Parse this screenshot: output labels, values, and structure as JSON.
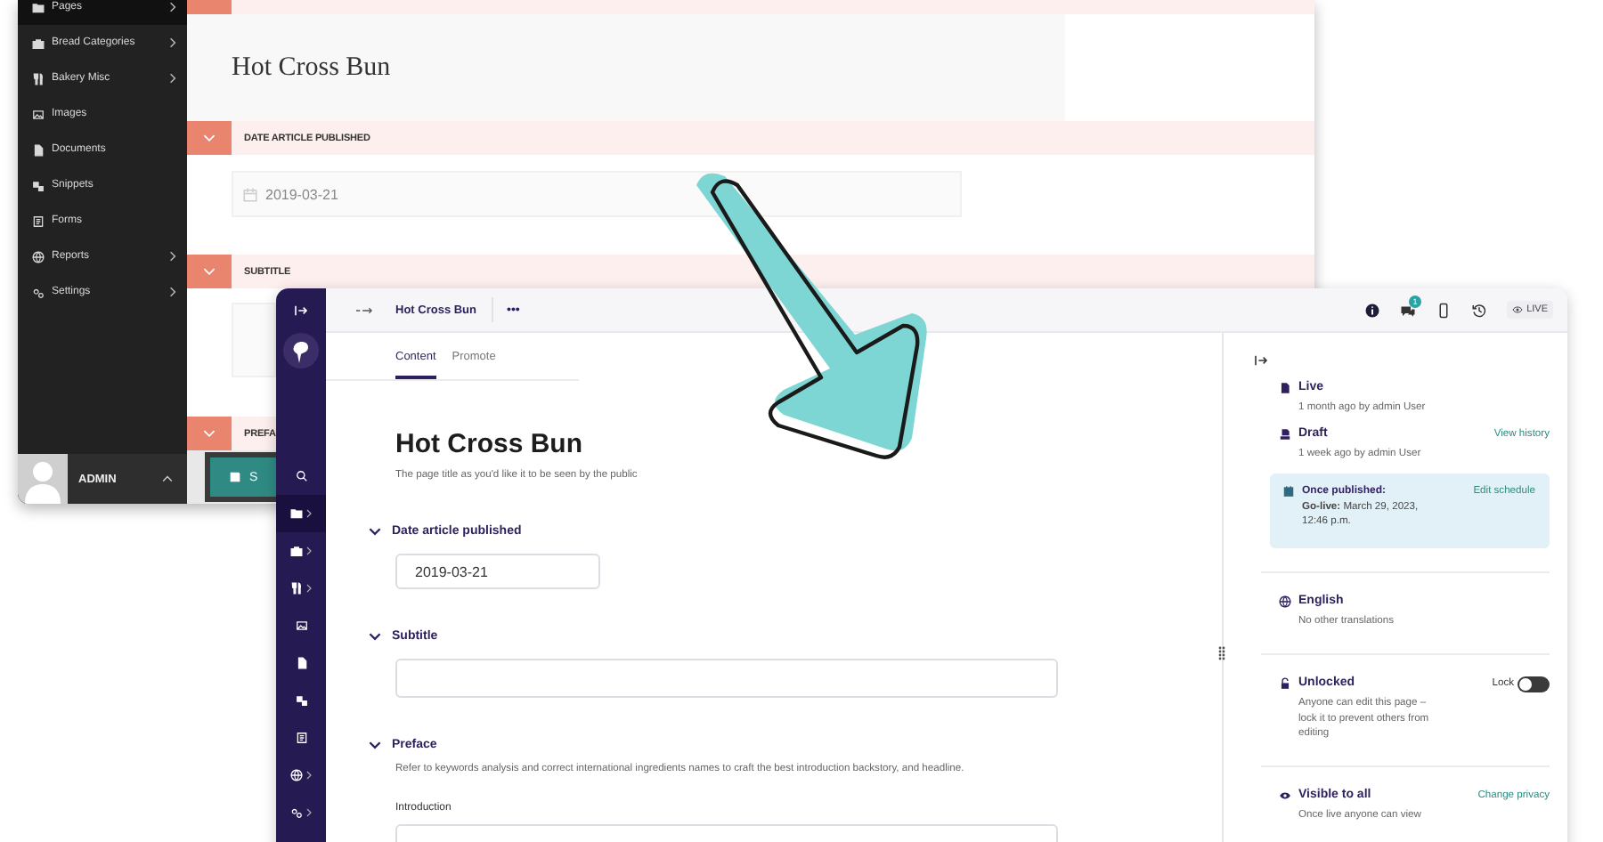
{
  "old_window": {
    "sidebar": {
      "items": [
        {
          "label": "Pages",
          "submenu": true,
          "selected": true
        },
        {
          "label": "Bread Categories",
          "submenu": true,
          "selected": false
        },
        {
          "label": "Bakery Misc",
          "submenu": true,
          "selected": false
        },
        {
          "label": "Images",
          "submenu": false,
          "selected": false
        },
        {
          "label": "Documents",
          "submenu": false,
          "selected": false
        },
        {
          "label": "Snippets",
          "submenu": false,
          "selected": false
        },
        {
          "label": "Forms",
          "submenu": false,
          "selected": false
        },
        {
          "label": "Reports",
          "submenu": true,
          "selected": false
        },
        {
          "label": "Settings",
          "submenu": true,
          "selected": false
        }
      ],
      "user": "ADMIN"
    },
    "sections": [
      {
        "kind": "title",
        "value": "Hot Cross Bun"
      },
      {
        "kind": "date",
        "heading": "DATE ARTICLE PUBLISHED",
        "value": "2019-03-21"
      },
      {
        "kind": "text",
        "heading": "SUBTITLE"
      },
      {
        "kind": "heading",
        "heading": "PREFA"
      }
    ],
    "save_button": {
      "label": "S"
    }
  },
  "new_window": {
    "nav": {
      "items": [
        {
          "selected": false,
          "submenu": false
        },
        {
          "selected": true,
          "submenu": true
        },
        {
          "selected": false,
          "submenu": true
        },
        {
          "selected": false,
          "submenu": true
        },
        {
          "selected": false,
          "submenu": false
        },
        {
          "selected": false,
          "submenu": false
        },
        {
          "selected": false,
          "submenu": false
        },
        {
          "selected": false,
          "submenu": false
        },
        {
          "selected": false,
          "submenu": true
        },
        {
          "selected": false,
          "submenu": true
        }
      ]
    },
    "topbar": {
      "title": "Hot Cross Bun",
      "more": "•••",
      "comment_count": "1",
      "status": "LIVE"
    },
    "tabs": [
      {
        "label": "Content",
        "selected": true
      },
      {
        "label": "Promote",
        "selected": false
      }
    ],
    "page_title": "Hot Cross Bun",
    "page_title_help": "The page title as you'd like it to be seen by the public",
    "sections": [
      {
        "kind": "date",
        "label": "Date article published",
        "expanded": true,
        "value": "2019-03-21"
      },
      {
        "kind": "text",
        "label": "Subtitle",
        "expanded": true
      },
      {
        "kind": "group",
        "label": "Preface",
        "expanded": true,
        "help": "Refer to keywords analysis and correct international ingredients names to craft the best introduction backstory, and headline.",
        "fields": [
          {
            "label": "Introduction"
          }
        ]
      }
    ],
    "side_panel": {
      "statuses": [
        {
          "kind": "live",
          "title": "Live",
          "detail": "1 month ago by admin User"
        },
        {
          "kind": "draft",
          "title": "Draft",
          "detail": "1 week ago by admin User",
          "action": "View history"
        }
      ],
      "schedule": {
        "title": "Once published:",
        "action": "Edit schedule",
        "detail": "**Go-live:** March 29, 2023, 12:46 p.m."
      },
      "locale": {
        "title": "English",
        "detail": "No other translations"
      },
      "lock": {
        "title": "Unlocked",
        "toggle_label": "Lock",
        "on": false,
        "detail": "Anyone can edit this page – lock it to prevent others from editing"
      },
      "privacy": {
        "title": "Visible to all",
        "action": "Change privacy",
        "detail": "Once live anyone can view"
      }
    }
  }
}
